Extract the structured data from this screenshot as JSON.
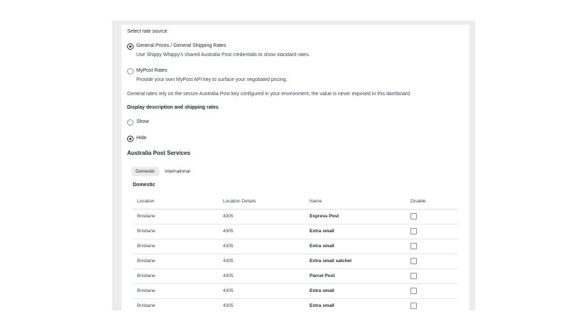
{
  "rate_source": {
    "heading": "Select rate source",
    "options": [
      {
        "label": "General Prices / General Shipping Rates",
        "description": "Use Shippy Whippy's shared Australia Post credentials to show standard rates.",
        "checked": true
      },
      {
        "label": "MyPost Rates",
        "description": "Provide your own MyPost API key to surface your negotiated pricing.",
        "checked": false
      }
    ],
    "note": "General rates rely on the secure Australia Post key configured in your environment; the value is never exposed in this dashboard."
  },
  "display": {
    "heading": "Display description and shipping rates",
    "options": [
      {
        "label": "Show",
        "checked": false
      },
      {
        "label": "Hide",
        "checked": true
      }
    ]
  },
  "services": {
    "heading": "Australia Post Services",
    "tabs": [
      {
        "label": "Domestic",
        "active": true
      },
      {
        "label": "International",
        "active": false
      }
    ],
    "section_title": "Domestic",
    "columns": [
      "Location",
      "Location Details",
      "Name",
      "Disable"
    ],
    "rows": [
      {
        "location": "Brisbane",
        "details": "4305",
        "name": "Express Post",
        "disabled": false
      },
      {
        "location": "Brisbane",
        "details": "4305",
        "name": "Extra small",
        "disabled": false
      },
      {
        "location": "Brisbane",
        "details": "4305",
        "name": "Extra small",
        "disabled": false
      },
      {
        "location": "Brisbane",
        "details": "4305",
        "name": "Extra small satchel",
        "disabled": false
      },
      {
        "location": "Brisbane",
        "details": "4305",
        "name": "Parcel Post",
        "disabled": false
      },
      {
        "location": "Brisbane",
        "details": "4305",
        "name": "Extra small",
        "disabled": false
      },
      {
        "location": "Brisbane",
        "details": "4305",
        "name": "Extra small",
        "disabled": false
      }
    ]
  }
}
